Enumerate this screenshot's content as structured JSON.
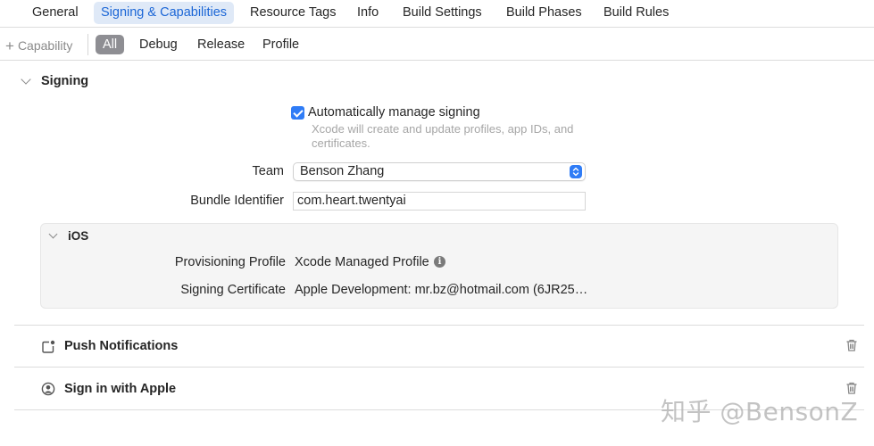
{
  "tabs": [
    "General",
    "Signing & Capabilities",
    "Resource Tags",
    "Info",
    "Build Settings",
    "Build Phases",
    "Build Rules"
  ],
  "active_tab": "Signing & Capabilities",
  "filterbar": {
    "add_capability": "Capability",
    "configs": [
      "All",
      "Debug",
      "Release",
      "Profile"
    ],
    "active_config": "All"
  },
  "signing": {
    "title": "Signing",
    "auto_manage_label": "Automatically manage signing",
    "auto_manage_checked": true,
    "auto_manage_desc": "Xcode will create and update profiles, app IDs, and certificates.",
    "team_label": "Team",
    "team_value": "Benson Zhang",
    "bundle_label": "Bundle Identifier",
    "bundle_value": "com.heart.twentyai",
    "ios": {
      "title": "iOS",
      "prov_label": "Provisioning Profile",
      "prov_value": "Xcode Managed Profile",
      "cert_label": "Signing Certificate",
      "cert_value": "Apple Development: mr.bz@hotmail.com (6JR25…"
    }
  },
  "capabilities": [
    {
      "name": "Push Notifications",
      "icon": "push-notifications-icon"
    },
    {
      "name": "Sign in with Apple",
      "icon": "sign-in-with-apple-icon"
    }
  ],
  "watermark": "知乎 @BensonZ",
  "colors": {
    "accent": "#2f7cf6",
    "active_tab_bg": "#dfe9f7",
    "active_tab_text": "#1b66d6"
  }
}
